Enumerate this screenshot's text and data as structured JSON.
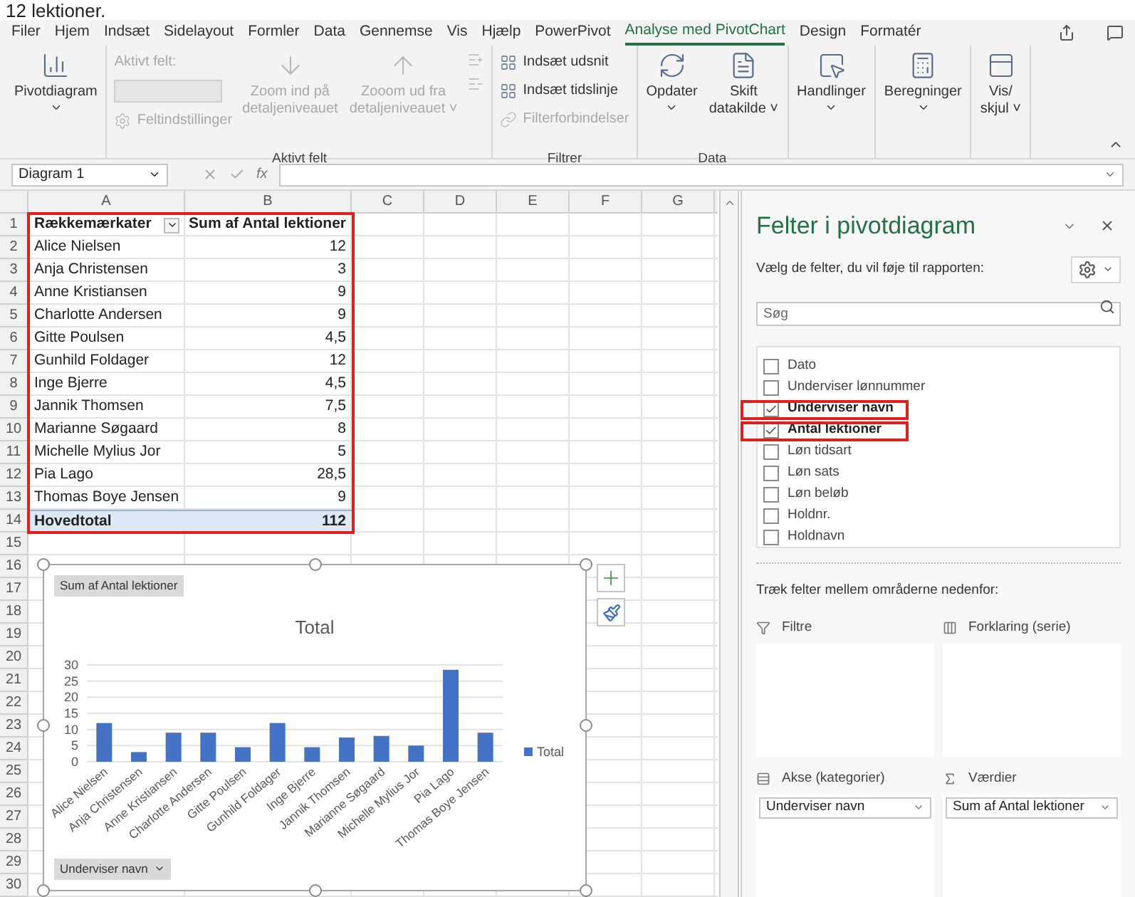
{
  "caption": "12 lektioner.",
  "menu_tabs": [
    {
      "label": "Filer",
      "selected": false
    },
    {
      "label": "Hjem",
      "selected": false
    },
    {
      "label": "Indsæt",
      "selected": false
    },
    {
      "label": "Sidelayout",
      "selected": false
    },
    {
      "label": "Formler",
      "selected": false
    },
    {
      "label": "Data",
      "selected": false
    },
    {
      "label": "Gennemse",
      "selected": false
    },
    {
      "label": "Vis",
      "selected": false
    },
    {
      "label": "Hjælp",
      "selected": false
    },
    {
      "label": "PowerPivot",
      "selected": false
    },
    {
      "label": "Analyse med PivotChart",
      "selected": true
    },
    {
      "label": "Design",
      "selected": false
    },
    {
      "label": "Formatér",
      "selected": false
    }
  ],
  "ribbon": [
    {
      "items": [
        {
          "kind": "large",
          "label": "Pivotdiagram",
          "dropdown": true,
          "disabled": false
        }
      ]
    },
    {
      "caption": "Aktivt felt",
      "items": [
        {
          "kind": "stack",
          "items": [
            {
              "kind": "label",
              "label": "Aktivt felt:",
              "disabled": true
            },
            {
              "kind": "field",
              "disabled": true
            },
            {
              "kind": "small",
              "label": "Feltindstillinger",
              "disabled": true
            }
          ]
        },
        {
          "kind": "large",
          "label": "Zoom ind på\ndetaljeniveauet",
          "dropdown": false,
          "disabled": true
        },
        {
          "kind": "large",
          "label": "Zooom ud fra\ndetaljeniveauet ˅",
          "dropdown": false,
          "disabled": true
        },
        {
          "kind": "stack",
          "items": [
            {
              "kind": "icon",
              "disabled": true
            },
            {
              "kind": "icon",
              "disabled": true
            }
          ]
        }
      ]
    },
    {
      "caption": "Filtrer",
      "items": [
        {
          "kind": "stack",
          "items": [
            {
              "kind": "small",
              "label": "Indsæt udsnit",
              "disabled": false
            },
            {
              "kind": "small",
              "label": "Indsæt tidslinje",
              "disabled": false
            },
            {
              "kind": "small",
              "label": "Filterforbindelser",
              "disabled": true
            }
          ]
        }
      ]
    },
    {
      "caption": "Data",
      "items": [
        {
          "kind": "large",
          "label": "Opdater",
          "dropdown": true,
          "disabled": false
        },
        {
          "kind": "large",
          "label": "Skift\ndatakilde ˅",
          "dropdown": false,
          "disabled": false
        }
      ]
    },
    {
      "items": [
        {
          "kind": "large",
          "label": "Handlinger",
          "dropdown": true,
          "disabled": false
        }
      ]
    },
    {
      "items": [
        {
          "kind": "large",
          "label": "Beregninger",
          "dropdown": true,
          "disabled": false
        }
      ]
    },
    {
      "items": [
        {
          "kind": "large",
          "label": "Vis/\nskjul ˅",
          "dropdown": false,
          "disabled": false
        }
      ]
    }
  ],
  "formula_bar": {
    "name_box": "Diagram 1",
    "fx": "fx"
  },
  "sheet": {
    "columns": [
      "A",
      "B",
      "C",
      "D",
      "E",
      "F",
      "G"
    ],
    "row_numbers": [
      "1",
      "2",
      "3",
      "4",
      "5",
      "6",
      "7",
      "8",
      "9",
      "10",
      "11",
      "12",
      "13",
      "14",
      "15",
      "16",
      "17",
      "18",
      "19",
      "20",
      "21",
      "22",
      "23",
      "24",
      "25",
      "26",
      "27",
      "28",
      "29",
      "30"
    ]
  },
  "pivot_table": {
    "highlighted": true,
    "header": [
      "Rækkemærkater",
      "Sum af Antal lektioner"
    ],
    "rows": [
      [
        "Alice Nielsen",
        "12"
      ],
      [
        "Anja Christensen",
        "3"
      ],
      [
        "Anne Kristiansen",
        "9"
      ],
      [
        "Charlotte Andersen",
        "9"
      ],
      [
        "Gitte Poulsen",
        "4,5"
      ],
      [
        "Gunhild Foldager",
        "12"
      ],
      [
        "Inge Bjerre",
        "4,5"
      ],
      [
        "Jannik Thomsen",
        "7,5"
      ],
      [
        "Marianne Søgaard",
        "8"
      ],
      [
        "Michelle Mylius Jor",
        "5"
      ],
      [
        "Pia Lago",
        "28,5"
      ],
      [
        "Thomas Boye Jensen",
        "9"
      ]
    ],
    "total": [
      "Hovedtotal",
      "112"
    ]
  },
  "chart": {
    "value_button": "Sum af Antal lektioner",
    "axis_button": "Underviser navn",
    "chart_data": {
      "type": "bar",
      "title": "Total",
      "grid": true,
      "categories": [
        "Alice Nielsen",
        "Anja Christensen",
        "Anne Kristiansen",
        "Charlotte Andersen",
        "Gitte Poulsen",
        "Gunhild Foldager",
        "Inge Bjerre",
        "Jannik Thomsen",
        "Marianne Søgaard",
        "Michelle Mylius Jor",
        "Pia Lago",
        "Thomas Boye Jensen"
      ],
      "series": [
        {
          "name": "Total",
          "color": "#4472c4",
          "values": [
            12,
            3,
            9,
            9,
            4.5,
            12,
            4.5,
            7.5,
            8,
            5,
            28.5,
            9
          ]
        }
      ],
      "ylim": [
        0,
        30
      ],
      "yticks": [
        0,
        5,
        10,
        15,
        20,
        25,
        30
      ]
    }
  },
  "field_pane": {
    "title": "Felter i pivotdiagram",
    "subtitle": "Vælg de felter, du vil føje til rapporten:",
    "search_placeholder": "Søg",
    "fields": [
      {
        "label": "Dato",
        "checked": false,
        "highlighted": false
      },
      {
        "label": "Underviser lønnummer",
        "checked": false,
        "highlighted": false
      },
      {
        "label": "Underviser navn",
        "checked": true,
        "highlighted": true
      },
      {
        "label": "Antal lektioner",
        "checked": true,
        "highlighted": true
      },
      {
        "label": "Løn tidsart",
        "checked": false,
        "highlighted": false
      },
      {
        "label": "Løn sats",
        "checked": false,
        "highlighted": false
      },
      {
        "label": "Løn beløb",
        "checked": false,
        "highlighted": false
      },
      {
        "label": "Holdnr.",
        "checked": false,
        "highlighted": false
      },
      {
        "label": "Holdnavn",
        "checked": false,
        "highlighted": false
      }
    ],
    "areas_hint": "Træk felter mellem områderne nedenfor:",
    "areas": [
      {
        "kind": "filter",
        "title": "Filtre"
      },
      {
        "kind": "legend",
        "title": "Forklaring (serie)"
      },
      {
        "kind": "axis",
        "title": "Akse (kategorier)",
        "items": [
          "Underviser navn"
        ]
      },
      {
        "kind": "values",
        "title": "Værdier",
        "items": [
          "Sum af Antal lektioner"
        ]
      }
    ]
  }
}
